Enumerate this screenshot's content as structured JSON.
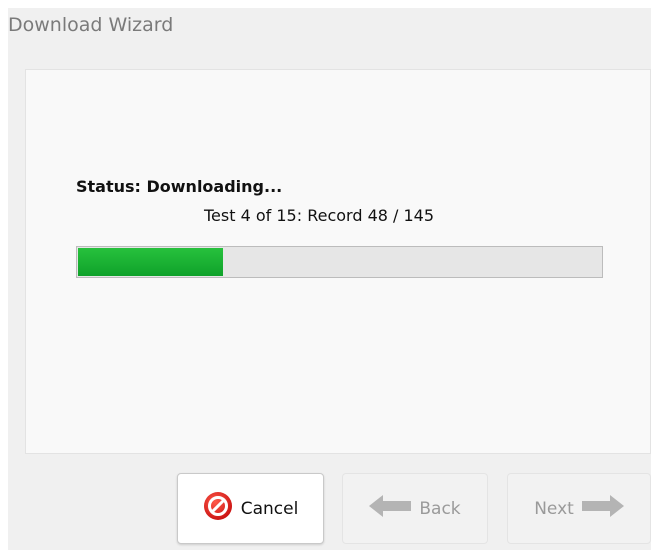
{
  "window": {
    "title": "Download Wizard"
  },
  "status": {
    "label": "Status: Downloading...",
    "detail": "Test 4 of 15: Record 48 / 145",
    "progress_fraction": 0.28
  },
  "buttons": {
    "cancel": {
      "label": "Cancel",
      "icon": "cancel-icon",
      "enabled": true
    },
    "back": {
      "label": "Back",
      "icon": "arrow-left-icon",
      "enabled": false
    },
    "next": {
      "label": "Next",
      "icon": "arrow-right-icon",
      "enabled": false
    }
  },
  "colors": {
    "progress_fill": "#1bb233",
    "cancel_icon": "#e02020",
    "disabled_arrow": "#b4b4b4"
  }
}
